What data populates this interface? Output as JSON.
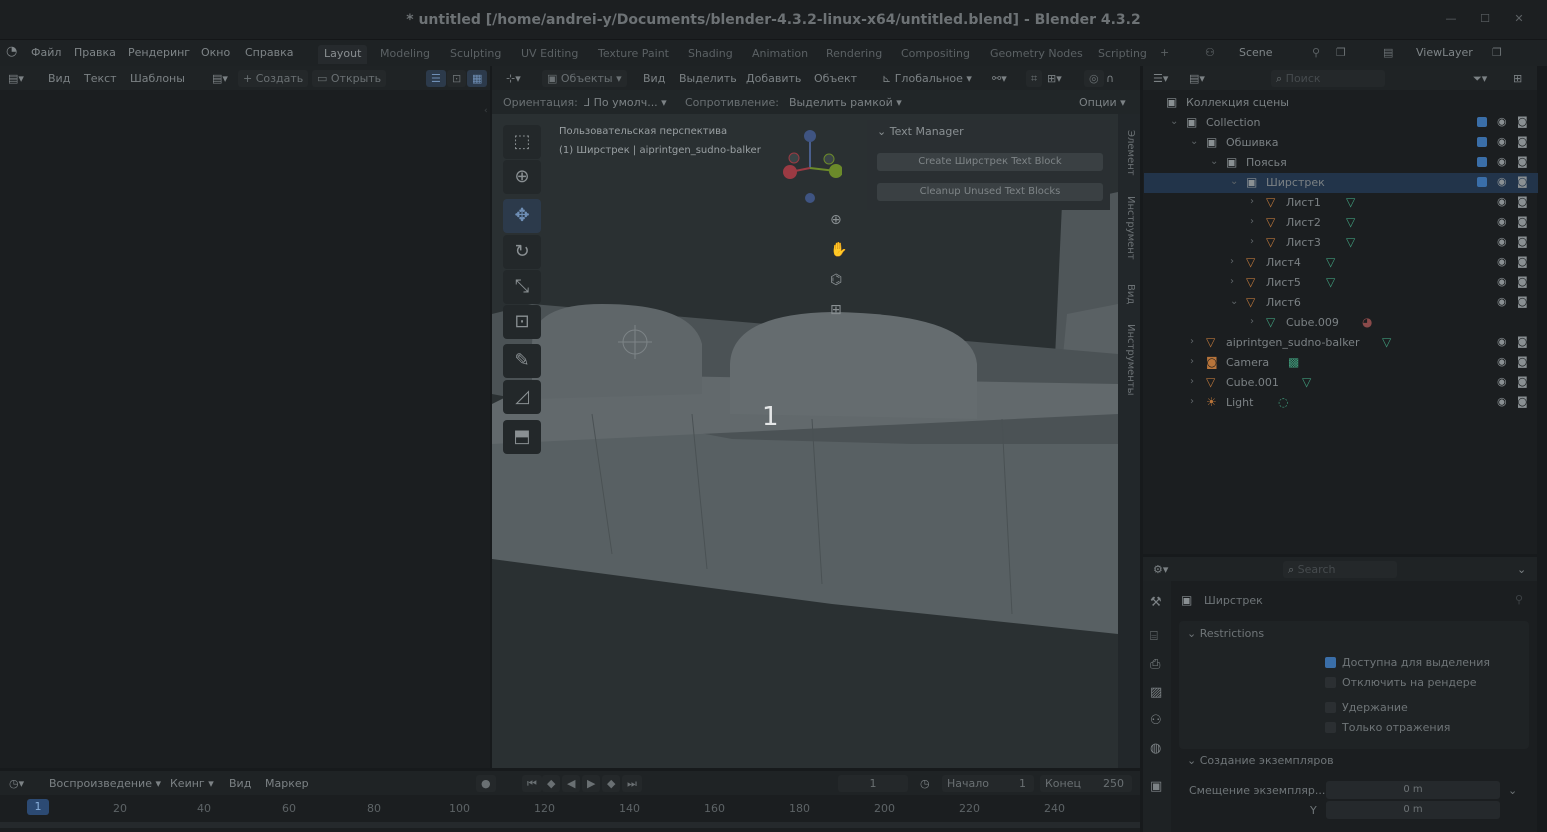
{
  "title": "* untitled [/home/andrei-y/Documents/blender-4.3.2-linux-x64/untitled.blend] - Blender 4.3.2",
  "menu": [
    "Файл",
    "Правка",
    "Рендеринг",
    "Окно",
    "Справка"
  ],
  "workspaces": [
    "Layout",
    "Modeling",
    "Sculpting",
    "UV Editing",
    "Texture Paint",
    "Shading",
    "Animation",
    "Rendering",
    "Compositing",
    "Geometry Nodes",
    "Scripting"
  ],
  "scene": {
    "label": "Scene",
    "viewlayer": "ViewLayer"
  },
  "text_editor": {
    "view": "Вид",
    "text": "Текст",
    "templates": "Шаблоны",
    "new": "Создать",
    "open": "Открыть"
  },
  "viewport": {
    "mode": "Объекты",
    "menu": [
      "Вид",
      "Выделить",
      "Добавить",
      "Объект"
    ],
    "transform": "Глобальное",
    "orientation_label": "Ориентация:",
    "orientation_value": "По умолч...",
    "snap_label": "Сопротивление:",
    "snap_value": "Выделить рамкой",
    "options": "Опции",
    "info_line1": "Пользовательская перспектива",
    "info_line2": "(1) Ширстрек | aiprintgen_sudno-balker",
    "center_number": "1",
    "tabs": [
      "Элемент",
      "Инструмент",
      "Вид",
      "Инструменты"
    ],
    "text_manager": {
      "header": "Text Manager",
      "btn1": "Create Ширстрек Text Block",
      "btn2": "Cleanup Unused Text Blocks"
    }
  },
  "outliner": {
    "search_placeholder": "Поиск",
    "items": [
      {
        "label": "Коллекция сцены"
      },
      {
        "label": "Collection"
      },
      {
        "label": "Обшивка"
      },
      {
        "label": "Пояcья"
      },
      {
        "label": "Ширстрек"
      },
      {
        "label": "Лист1"
      },
      {
        "label": "Лист2"
      },
      {
        "label": "Лист3"
      },
      {
        "label": "Лист4"
      },
      {
        "label": "Лист5"
      },
      {
        "label": "Лист6"
      },
      {
        "label": "Cube.009"
      },
      {
        "label": "aiprintgen_sudno-balker"
      },
      {
        "label": "Camera"
      },
      {
        "label": "Cube.001"
      },
      {
        "label": "Light"
      }
    ]
  },
  "properties": {
    "search_placeholder": "Search",
    "name": "Ширстрек",
    "restrictions": "Restrictions",
    "selectable": "Доступна для выделения",
    "disable_render": "Отключить на рендере",
    "holdout": "Удержание",
    "indirect_only": "Только отражения",
    "instancing": "Создание экземпляров",
    "instance_offset": "Смещение экземпляр...",
    "offset_x": "0 m",
    "y_label": "Y",
    "offset_y": "0 m"
  },
  "timeline": {
    "playback": "Воспроизведение",
    "keying": "Кеинг",
    "view": "Вид",
    "marker": "Маркер",
    "frame": "1",
    "start_label": "Начало",
    "start": "1",
    "end_label": "Конец",
    "end": "250",
    "ticks": [
      "1",
      "20",
      "40",
      "60",
      "80",
      "100",
      "120",
      "140",
      "160",
      "180",
      "200",
      "220",
      "240"
    ]
  }
}
